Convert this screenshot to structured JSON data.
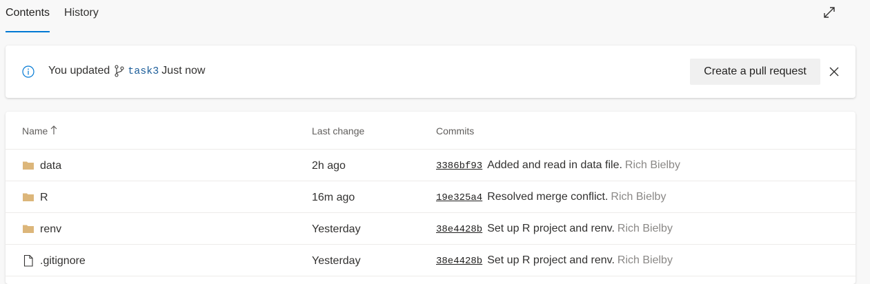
{
  "tabs": [
    {
      "label": "Contents",
      "active": true
    },
    {
      "label": "History",
      "active": false
    }
  ],
  "icons": {
    "expand": "expand-icon",
    "info": "info-icon",
    "branch": "branch-icon",
    "close": "close-icon",
    "folder": "folder-icon",
    "file": "file-icon",
    "sort": "sort-ascending-icon"
  },
  "colors": {
    "accent": "#0078d4",
    "folder": "#dcb67a",
    "branch_text": "#1c5d99",
    "author_text": "#8a8886"
  },
  "banner": {
    "prefix": "You updated",
    "branch": "task3",
    "suffix": "Just now",
    "pr_button": "Create a pull request"
  },
  "table": {
    "headers": {
      "name": "Name",
      "last_change": "Last change",
      "commits": "Commits"
    },
    "rows": [
      {
        "type": "folder",
        "name": "data",
        "last_change": "2h ago",
        "hash": "3386bf93",
        "message": "Added and read in data file.",
        "author": "Rich Bielby"
      },
      {
        "type": "folder",
        "name": "R",
        "last_change": "16m ago",
        "hash": "19e325a4",
        "message": "Resolved merge conflict.",
        "author": "Rich Bielby"
      },
      {
        "type": "folder",
        "name": "renv",
        "last_change": "Yesterday",
        "hash": "38e4428b",
        "message": "Set up R project and renv.",
        "author": "Rich Bielby"
      },
      {
        "type": "file",
        "name": ".gitignore",
        "last_change": "Yesterday",
        "hash": "38e4428b",
        "message": "Set up R project and renv.",
        "author": "Rich Bielby"
      }
    ]
  }
}
